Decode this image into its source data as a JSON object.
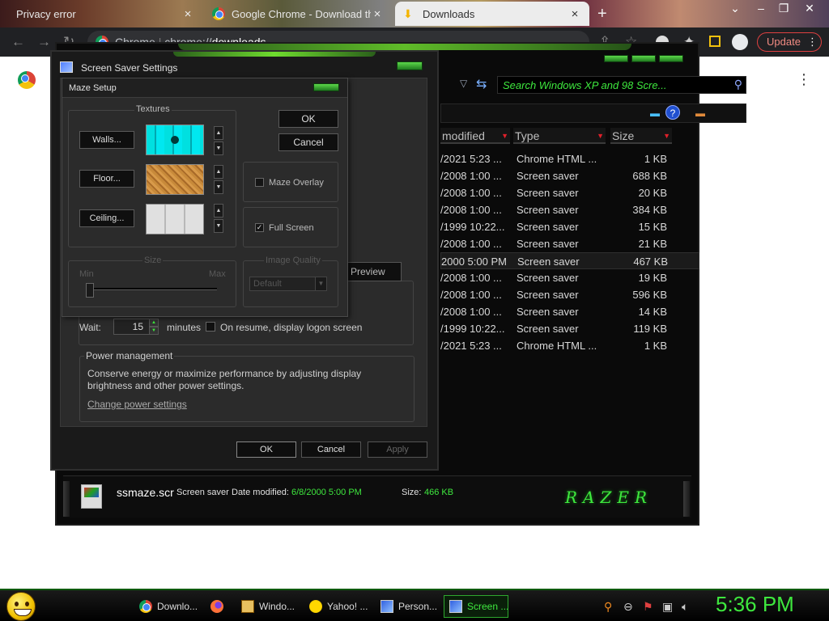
{
  "browser": {
    "tabs": [
      {
        "title": "Privacy error",
        "close": "×"
      },
      {
        "title": "Google Chrome - Download the",
        "close": "×"
      },
      {
        "title": "Downloads",
        "close": "×"
      }
    ],
    "new_tab": "+",
    "window_controls": {
      "chevron": "⌄",
      "minimize": "–",
      "maximize": "❐",
      "close": "✕"
    },
    "toolbar": {
      "back": "←",
      "forward": "→",
      "reload": "↻",
      "origin_label": "Chrome",
      "url_scheme": "chrome://",
      "url_path": "downloads",
      "update_label": "Update",
      "menu": "⋮",
      "share_icon": "share-icon",
      "star_icon": "star-icon"
    },
    "page_menu": "⋮"
  },
  "explorer": {
    "search_placeholder": "Search Windows XP and 98 Scre...",
    "columns": {
      "date": "modified",
      "type": "Type",
      "size": "Size"
    },
    "rows": [
      {
        "date": "/2021 5:23 ...",
        "type": "Chrome HTML ...",
        "size": "1 KB"
      },
      {
        "date": "/2008 1:00 ...",
        "type": "Screen saver",
        "size": "688 KB"
      },
      {
        "date": "/2008 1:00 ...",
        "type": "Screen saver",
        "size": "20 KB"
      },
      {
        "date": "/2008 1:00 ...",
        "type": "Screen saver",
        "size": "384 KB"
      },
      {
        "date": "/1999 10:22...",
        "type": "Screen saver",
        "size": "15 KB"
      },
      {
        "date": "/2008 1:00 ...",
        "type": "Screen saver",
        "size": "21 KB"
      },
      {
        "date": "2000 5:00 PM",
        "type": "Screen saver",
        "size": "467 KB"
      },
      {
        "date": "/2008 1:00 ...",
        "type": "Screen saver",
        "size": "19 KB"
      },
      {
        "date": "/2008 1:00 ...",
        "type": "Screen saver",
        "size": "596 KB"
      },
      {
        "date": "/2008 1:00 ...",
        "type": "Screen saver",
        "size": "14 KB"
      },
      {
        "date": "/1999 10:22...",
        "type": "Screen saver",
        "size": "119 KB"
      },
      {
        "date": "/2021 5:23 ...",
        "type": "Chrome HTML ...",
        "size": "1 KB"
      }
    ],
    "selected_row": 6,
    "details": {
      "name": "ssmaze.scr",
      "type": "Screen saver",
      "date_label": "Date modified:",
      "date_value": "6/8/2000 5:00 PM",
      "size_label": "Size:",
      "size_value": "466 KB",
      "brand": "RAZER"
    },
    "help": "?"
  },
  "screensaver": {
    "title": "Screen Saver Settings",
    "preview_label": "Preview",
    "wait_label": "Wait:",
    "wait_value": "15",
    "minutes_label": "minutes",
    "resume_label": "On resume, display logon screen",
    "resume_checked": false,
    "power_title": "Power management",
    "power_desc": "Conserve energy or maximize performance by adjusting display brightness and other power settings.",
    "power_link": "Change power settings",
    "ok": "OK",
    "cancel": "Cancel",
    "apply": "Apply"
  },
  "maze": {
    "title": "Maze Setup",
    "textures_title": "Textures",
    "walls": "Walls...",
    "floor": "Floor...",
    "ceiling": "Ceiling...",
    "ok": "OK",
    "cancel": "Cancel",
    "maze_overlay": "Maze Overlay",
    "maze_overlay_checked": false,
    "full_screen": "Full Screen",
    "full_screen_checked": true,
    "size_title": "Size",
    "min_label": "Min",
    "max_label": "Max",
    "size_value": 0.0,
    "image_quality_title": "Image Quality",
    "image_quality_value": "Default"
  },
  "taskbar": {
    "items": [
      {
        "label": "Downlo...",
        "icon": "chrome-icon"
      },
      {
        "label": "",
        "icon": "firefox-icon"
      },
      {
        "label": "Windo...",
        "icon": "folder-icon"
      },
      {
        "label": "Yahoo! ...",
        "icon": "yahoo-icon"
      },
      {
        "label": "Person...",
        "icon": "display-icon"
      },
      {
        "label": "Screen ...",
        "icon": "display-icon"
      }
    ],
    "active_index": 5,
    "clock": "5:36 PM"
  },
  "colors": {
    "accent_green": "#3ee83e",
    "update_red": "#e04040",
    "sort_red": "#e0202a"
  }
}
